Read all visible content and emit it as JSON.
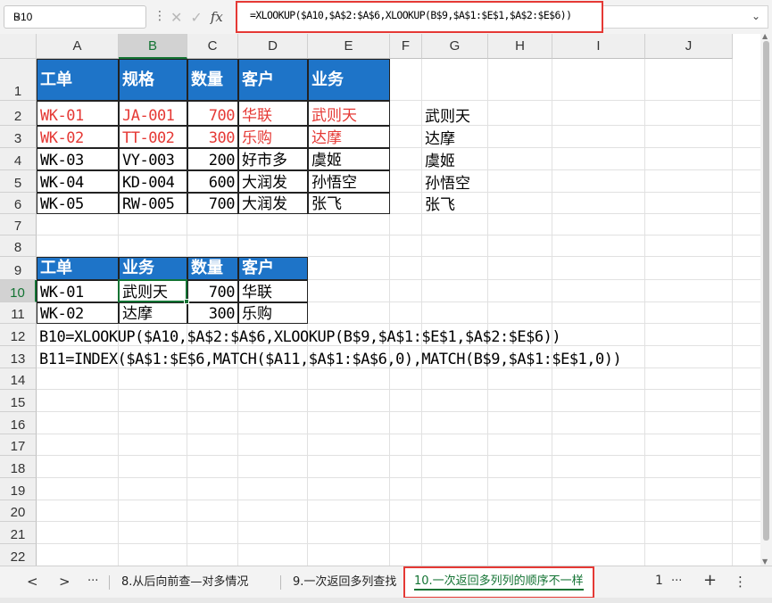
{
  "formula_bar": {
    "cell_ref": "B10",
    "formula": "=XLOOKUP($A10,$A$2:$A$6,XLOOKUP(B$9,$A$1:$E$1,$A$2:$E$6))",
    "fx_label": "fx"
  },
  "columns": [
    "A",
    "B",
    "C",
    "D",
    "E",
    "F",
    "G",
    "H",
    "I",
    "J"
  ],
  "rows": [
    "1",
    "2",
    "3",
    "4",
    "5",
    "6",
    "7",
    "8",
    "9",
    "10",
    "11",
    "12",
    "13",
    "14",
    "15",
    "16",
    "17",
    "18",
    "19",
    "20",
    "21",
    "22"
  ],
  "table1": {
    "headers": [
      "工单",
      "规格",
      "数量",
      "客户",
      "业务"
    ],
    "rows": [
      [
        "WK-01",
        "JA-001",
        "700",
        "华联",
        "武则天"
      ],
      [
        "WK-02",
        "TT-002",
        "300",
        "乐购",
        "达摩"
      ],
      [
        "WK-03",
        "VY-003",
        "200",
        "好市多",
        "虞姬"
      ],
      [
        "WK-04",
        "KD-004",
        "600",
        "大润发",
        "孙悟空"
      ],
      [
        "WK-05",
        "RW-005",
        "700",
        "大润发",
        "张飞"
      ]
    ]
  },
  "side_list": [
    "武则天",
    "达摩",
    "虞姬",
    "孙悟空",
    "张飞"
  ],
  "table2": {
    "headers": [
      "工单",
      "业务",
      "数量",
      "客户"
    ],
    "rows": [
      [
        "WK-01",
        "武则天",
        "700",
        "华联"
      ],
      [
        "WK-02",
        "达摩",
        "300",
        "乐购"
      ]
    ]
  },
  "notes": {
    "b10": "B10=XLOOKUP($A10,$A$2:$A$6,XLOOKUP(B$9,$A$1:$E$1,$A$2:$E$6))",
    "b11": "B11=INDEX($A$1:$E$6,MATCH($A11,$A$1:$A$6,0),MATCH(B$9,$A$1:$E$1,0))"
  },
  "tabs": {
    "prev": "<",
    "next": ">",
    "more_left": "···",
    "items": [
      "8.从后向前查—对多情况",
      "9.一次返回多列查找",
      "10.一次返回多列列的顺序不一样"
    ],
    "page_num": "1",
    "more_right": "···",
    "add": "+",
    "menu": "⋮"
  },
  "colors": {
    "header_fill": "#1e74c8",
    "highlight_red": "#e53935",
    "selection_green": "#137333"
  }
}
